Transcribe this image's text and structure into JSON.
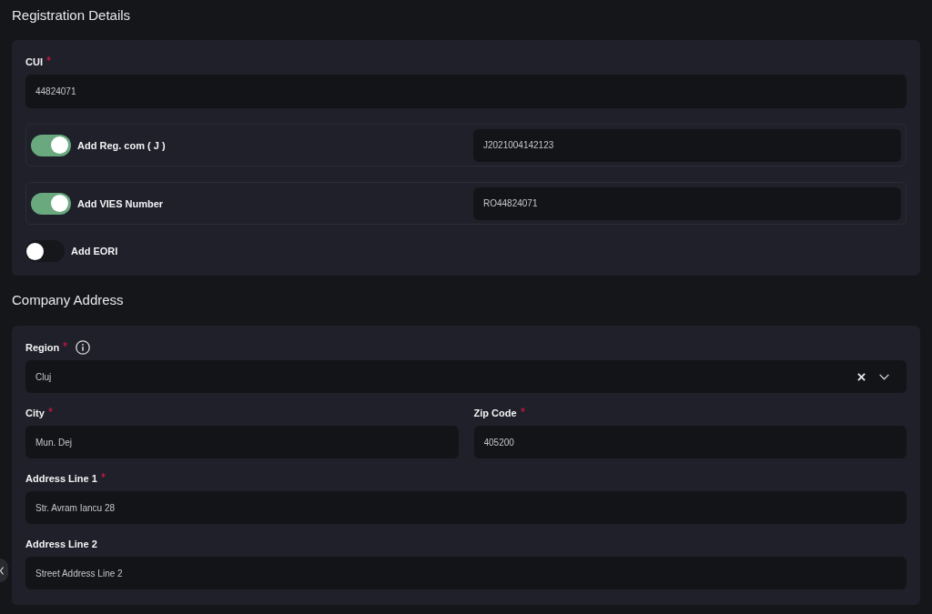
{
  "registration_details": {
    "title": "Registration Details",
    "cui": {
      "label": "CUI",
      "required": true,
      "value": "44824071"
    },
    "toggles": [
      {
        "label": "Add Reg. com ( J )",
        "on": true,
        "value": "J2021004142123"
      },
      {
        "label": "Add VIES Number",
        "on": true,
        "value": "RO44824071"
      },
      {
        "label": "Add EORI",
        "on": false
      }
    ]
  },
  "company_address": {
    "title": "Company Address",
    "rows": [
      {
        "fields": [
          {
            "label": "Region",
            "required": true,
            "info": true,
            "kind": "select",
            "value": "Cluj"
          }
        ]
      },
      {
        "fields": [
          {
            "label": "City",
            "required": true,
            "info": false,
            "kind": "text",
            "value": "Mun. Dej"
          },
          {
            "label": "Zip Code",
            "required": true,
            "info": false,
            "kind": "text",
            "value": "405200"
          }
        ]
      },
      {
        "fields": [
          {
            "label": "Address Line 1",
            "required": true,
            "info": false,
            "kind": "text",
            "value": "Str. Avram Iancu 28"
          }
        ]
      },
      {
        "fields": [
          {
            "label": "Address Line 2",
            "required": false,
            "info": false,
            "kind": "text",
            "placeholder": "Street Address Line 2"
          }
        ]
      }
    ]
  }
}
